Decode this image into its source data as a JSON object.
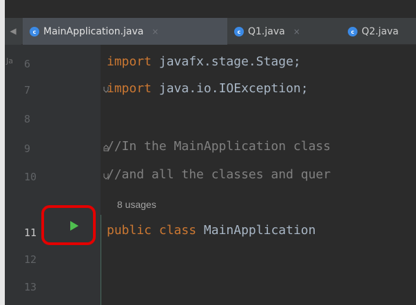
{
  "tabs": [
    {
      "label": "MainApplication.java",
      "active": true,
      "icon": "java-class-icon"
    },
    {
      "label": "Q1.java",
      "active": false,
      "icon": "java-class-icon"
    },
    {
      "label": "Q2.java",
      "active": false,
      "icon": "java-class-icon"
    }
  ],
  "tab_close_symbol": "×",
  "tabs_scroll_arrow": "◀",
  "gutter_hint": "Ja",
  "lines": [
    {
      "number": "6",
      "code": ""
    },
    {
      "number": "7",
      "code": ""
    },
    {
      "number": "8",
      "code": ""
    },
    {
      "number": "9",
      "code": ""
    },
    {
      "number": "10",
      "code": ""
    },
    {
      "number": "11",
      "code": ""
    },
    {
      "number": "12",
      "code": ""
    },
    {
      "number": "13",
      "code": ""
    }
  ],
  "code": {
    "line6_kw": "import",
    "line6_rest": " javafx.stage.Stage;",
    "line7_kw": "import",
    "line7_rest": " java.io.IOException;",
    "line9_comment": "//In the MainApplication class",
    "line10_comment": "//and all the classes and quer",
    "usages": "8 usages",
    "line11_kw1": "public",
    "line11_kw2": "class",
    "line11_name": "MainApplication"
  },
  "run_gutter_icon": "run-triangle-icon",
  "colors": {
    "keyword": "#cc7832",
    "comment": "#808080",
    "text": "#a9b7c6",
    "run_icon": "#4fbf4f",
    "highlight_box": "#e30000",
    "tab_icon": "#3b8ae6"
  }
}
